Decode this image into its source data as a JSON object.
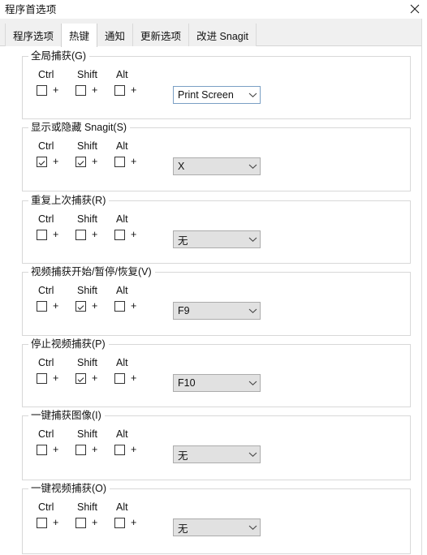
{
  "window": {
    "title": "程序首选项",
    "close_icon": "close-icon"
  },
  "tabs": [
    {
      "label": "程序选项",
      "active": false
    },
    {
      "label": "热键",
      "active": true
    },
    {
      "label": "通知",
      "active": false
    },
    {
      "label": "更新选项",
      "active": false
    },
    {
      "label": "改进 Snagit",
      "active": false
    }
  ],
  "modifier_labels": {
    "ctrl": "Ctrl",
    "shift": "Shift",
    "alt": "Alt",
    "plus": "+"
  },
  "colors": {
    "combo_focus_border": "#7a9fc4",
    "combo_disabled_bg": "#e1e1e1",
    "group_border": "#d8d8d8",
    "tabstrip_bg": "#f0f0f0"
  },
  "groups": [
    {
      "label": "全局捕获(G)",
      "ctrl_checked": false,
      "shift_checked": false,
      "alt_checked": false,
      "key_value": "Print Screen",
      "focused": true
    },
    {
      "label": "显示或隐藏 Snagit(S)",
      "ctrl_checked": true,
      "shift_checked": true,
      "alt_checked": false,
      "key_value": "X",
      "focused": false
    },
    {
      "label": "重复上次捕获(R)",
      "ctrl_checked": false,
      "shift_checked": false,
      "alt_checked": false,
      "key_value": "无",
      "focused": false
    },
    {
      "label": "视频捕获开始/暂停/恢复(V)",
      "ctrl_checked": false,
      "shift_checked": true,
      "alt_checked": false,
      "key_value": "F9",
      "focused": false
    },
    {
      "label": "停止视频捕获(P)",
      "ctrl_checked": false,
      "shift_checked": true,
      "alt_checked": false,
      "key_value": "F10",
      "focused": false
    },
    {
      "label": "一键捕获图像(I)",
      "ctrl_checked": false,
      "shift_checked": false,
      "alt_checked": false,
      "key_value": "无",
      "focused": false
    },
    {
      "label": "一键视频捕获(O)",
      "ctrl_checked": false,
      "shift_checked": false,
      "alt_checked": false,
      "key_value": "无",
      "focused": false
    }
  ]
}
